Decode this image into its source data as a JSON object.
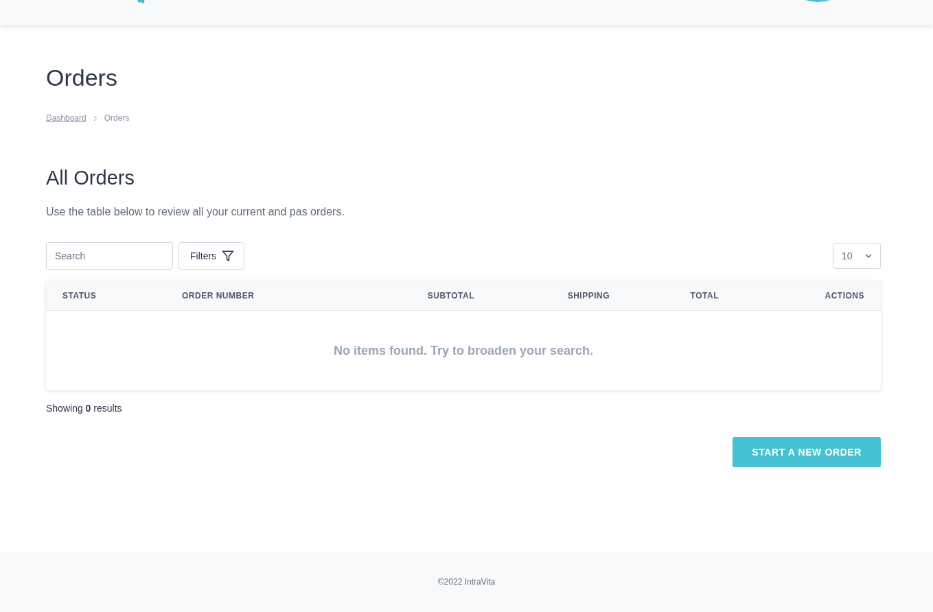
{
  "page": {
    "title": "Orders"
  },
  "breadcrumb": [
    {
      "label": "Dashboard",
      "kind": "link"
    },
    {
      "label": "Orders",
      "kind": "current"
    }
  ],
  "section": {
    "title": "All Orders",
    "description": "Use the table below to review all your current and pas orders."
  },
  "search": {
    "placeholder": "Search"
  },
  "filters_button": {
    "label": "Filters"
  },
  "page_size": {
    "value": "10"
  },
  "table": {
    "columns": [
      "STATUS",
      "ORDER NUMBER",
      "SUBTOTAL",
      "SHIPPING",
      "TOTAL",
      "ACTIONS"
    ],
    "empty_message": "No items found. Try to broaden your search."
  },
  "results": {
    "prefix": "Showing",
    "count": "0",
    "suffix": "results"
  },
  "new_order_button": {
    "label": "START A NEW ORDER"
  },
  "footer": {
    "text": "©2022 IntraVita"
  }
}
